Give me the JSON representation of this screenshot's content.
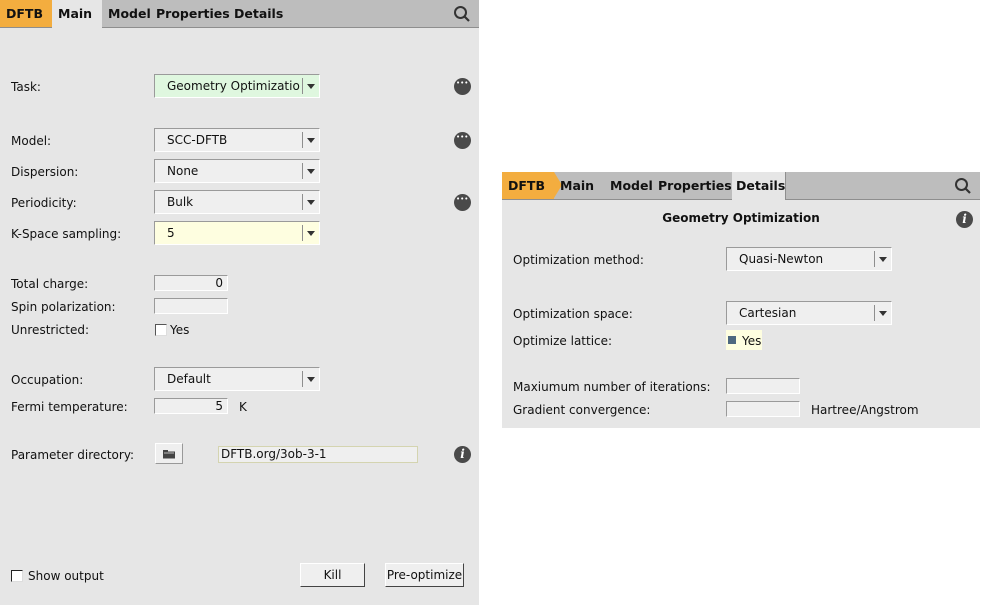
{
  "left_panel": {
    "breadcrumb": "DFTB",
    "tabs": [
      {
        "label": "Main",
        "active": true
      },
      {
        "label": "Model",
        "active": false
      },
      {
        "label": "Properties",
        "active": false
      },
      {
        "label": "Details",
        "active": false
      }
    ],
    "task": {
      "label": "Task:",
      "value": "Geometry Optimizatio"
    },
    "model": {
      "label": "Model:",
      "value": "SCC-DFTB"
    },
    "dispersion": {
      "label": "Dispersion:",
      "value": "None"
    },
    "periodicity": {
      "label": "Periodicity:",
      "value": "Bulk"
    },
    "kspace": {
      "label": "K-Space sampling:",
      "value": "5"
    },
    "total_charge": {
      "label": "Total charge:",
      "value": "0"
    },
    "spin_polarization": {
      "label": "Spin polarization:",
      "value": ""
    },
    "unrestricted": {
      "label": "Unrestricted:",
      "option": "Yes",
      "checked": false
    },
    "occupation": {
      "label": "Occupation:",
      "value": "Default"
    },
    "fermi_temperature": {
      "label": "Fermi temperature:",
      "value": "5",
      "unit": "K"
    },
    "parameter_directory": {
      "label": "Parameter directory:",
      "value": "DFTB.org/3ob-3-1"
    },
    "show_output": {
      "label": "Show output",
      "checked": false
    },
    "buttons": {
      "kill": "Kill",
      "preoptimize": "Pre-optimize"
    }
  },
  "right_panel": {
    "breadcrumb": "DFTB",
    "tabs": [
      {
        "label": "Main",
        "active": false
      },
      {
        "label": "Model",
        "active": false
      },
      {
        "label": "Properties",
        "active": false
      },
      {
        "label": "Details",
        "active": true
      }
    ],
    "section_title": "Geometry Optimization",
    "optimization_method": {
      "label": "Optimization method:",
      "value": "Quasi-Newton"
    },
    "optimization_space": {
      "label": "Optimization space:",
      "value": "Cartesian"
    },
    "optimize_lattice": {
      "label": "Optimize lattice:",
      "option": "Yes",
      "checked": true
    },
    "max_iterations": {
      "label": "Maxiumum number of iterations:",
      "value": ""
    },
    "gradient_convergence": {
      "label": "Gradient convergence:",
      "value": "",
      "unit": "Hartree/Angstrom"
    }
  },
  "colors": {
    "breadcrumb": "#f3ad3f",
    "panel_bg": "#e6e6e6",
    "tabbar_bg": "#bdbdbd",
    "task_bg": "#dff7df",
    "highlight_bg": "#fefee0",
    "checked_fill": "#4d6880"
  }
}
